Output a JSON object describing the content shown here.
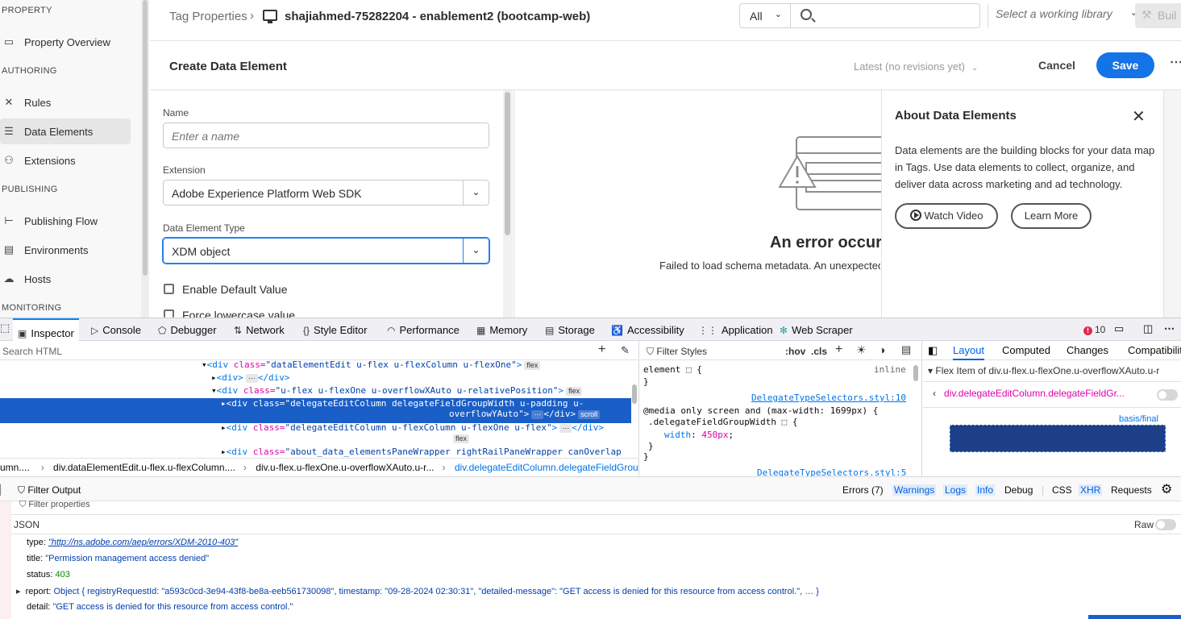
{
  "sidebar": {
    "sections": {
      "property": "PROPERTY",
      "authoring": "AUTHORING",
      "publishing": "PUBLISHING",
      "monitoring": "MONITORING"
    },
    "items": [
      {
        "label": "Property Overview",
        "icon": "monitor-icon"
      },
      {
        "label": "Rules",
        "icon": "tools-icon"
      },
      {
        "label": "Data Elements",
        "icon": "database-icon",
        "active": true
      },
      {
        "label": "Extensions",
        "icon": "plug-icon"
      },
      {
        "label": "Publishing Flow",
        "icon": "flow-icon"
      },
      {
        "label": "Environments",
        "icon": "window-icon"
      },
      {
        "label": "Hosts",
        "icon": "cloud-icon"
      }
    ]
  },
  "header": {
    "breadcrumb_root": "Tag Properties",
    "property_name": "shajiahmed-75282204 - enablement2 (bootcamp-web)",
    "filter_select": "All",
    "search_placeholder": "",
    "library_placeholder": "Select a working library",
    "build_label": "Buil"
  },
  "editor": {
    "title": "Create Data Element",
    "revisions": "Latest (no revisions yet)",
    "cancel": "Cancel",
    "save": "Save",
    "name_label": "Name",
    "name_placeholder": "Enter a name",
    "extension_label": "Extension",
    "extension_value": "Adobe Experience Platform Web SDK",
    "type_label": "Data Element Type",
    "type_value": "XDM object",
    "enable_default": "Enable Default Value",
    "force_lowercase": "Force lowercase value"
  },
  "error": {
    "title": "An error occurred",
    "description": "Failed to load schema metadata. An unexpected error occurred."
  },
  "about": {
    "title": "About Data Elements",
    "body": "Data elements are the building blocks for your data map in Tags. Use data elements to collect, organize, and deliver data across marketing and ad technology.",
    "watch_video": "Watch Video",
    "learn_more": "Learn More"
  },
  "devtools": {
    "tabs": [
      "Inspector",
      "Console",
      "Debugger",
      "Network",
      "Style Editor",
      "Performance",
      "Memory",
      "Storage",
      "Accessibility",
      "Application",
      "Web Scraper"
    ],
    "error_count": "10",
    "search_html": "Search HTML",
    "filter_styles": "Filter Styles",
    "hov": ":hov",
    "cls": ".cls",
    "layout_tabs": [
      "Layout",
      "Computed",
      "Changes",
      "Compatibility"
    ],
    "flex_item_title": "Flex Item of div.u-flex.u-flexOne.u-overflowXAuto.u-r",
    "flex_selector": "div.delegateEditColumn.delegateFieldGr...",
    "basis_label": "basis/final",
    "html_lines": {
      "l1_tag": "<div ",
      "l1_attr": "class=",
      "l1_val": "\"dataElementEdit u-flex u-flexColumn u-flexOne\"",
      "l1_badge": "flex",
      "l2": "<div>",
      "l2_end": "</div>",
      "l3_val": "\"u-flex u-flexOne u-overflowXAuto u-relativePosition\"",
      "l3_badge": "flex",
      "l4_val": "\"delegateEditColumn delegateFieldGroupWidth u-padding u-",
      "l4b_val": "overflowYAuto\"",
      "l4_badge": "scroll",
      "l5_val": "\"delegateEditColumn u-flexColumn u-flexOne u-flex\"",
      "l5_badge": "flex",
      "l6_val": "\"about_data_elementsPaneWrapper rightRailPaneWrapper canOverlap"
    },
    "crumbs": [
      "umn....",
      "div.dataElementEdit.u-flex.u-flexColumn....",
      "div.u-flex.u-flexOne.u-overflowXAuto.u-r...",
      "div.delegateEditColumn.delegateFieldGrou..."
    ],
    "rules": {
      "element": "element ",
      "inline": "inline",
      "close": "}",
      "link1": "DelegateTypeSelectors.styl:10",
      "media": "@media only screen and (max-width: 1699px) {",
      "selector": ".delegateFieldGroupWidth ",
      "prop": "width",
      "value": "450px",
      "link2": "DelegateTypeSelectors.styl:5"
    },
    "console_filters": {
      "filter_output": "Filter Output",
      "errors": "Errors (7)",
      "warnings": "Warnings",
      "logs": "Logs",
      "info": "Info",
      "debug": "Debug",
      "css": "CSS",
      "xhr": "XHR",
      "requests": "Requests"
    },
    "console": {
      "filter_props": "Filter properties",
      "json": "JSON",
      "raw": "Raw",
      "type_key": "type:",
      "type_val": "\"http://ns.adobe.com/aep/errors/XDM-2010-403\"",
      "title_key": "title:",
      "title_val": "\"Permission management access denied\"",
      "status_key": "status:",
      "status_val": "403",
      "report_key": "report:",
      "report_val": "Object { registryRequestId: \"a593c0cd-3e94-43f8-be8a-eeb561730098\", timestamp: \"09-28-2024 02:30:31\", \"detailed-message\": \"GET access is denied for this resource from access control.\", … }",
      "detail_key": "detail:",
      "detail_val": "\"GET access is denied for this resource from access control.\""
    }
  }
}
